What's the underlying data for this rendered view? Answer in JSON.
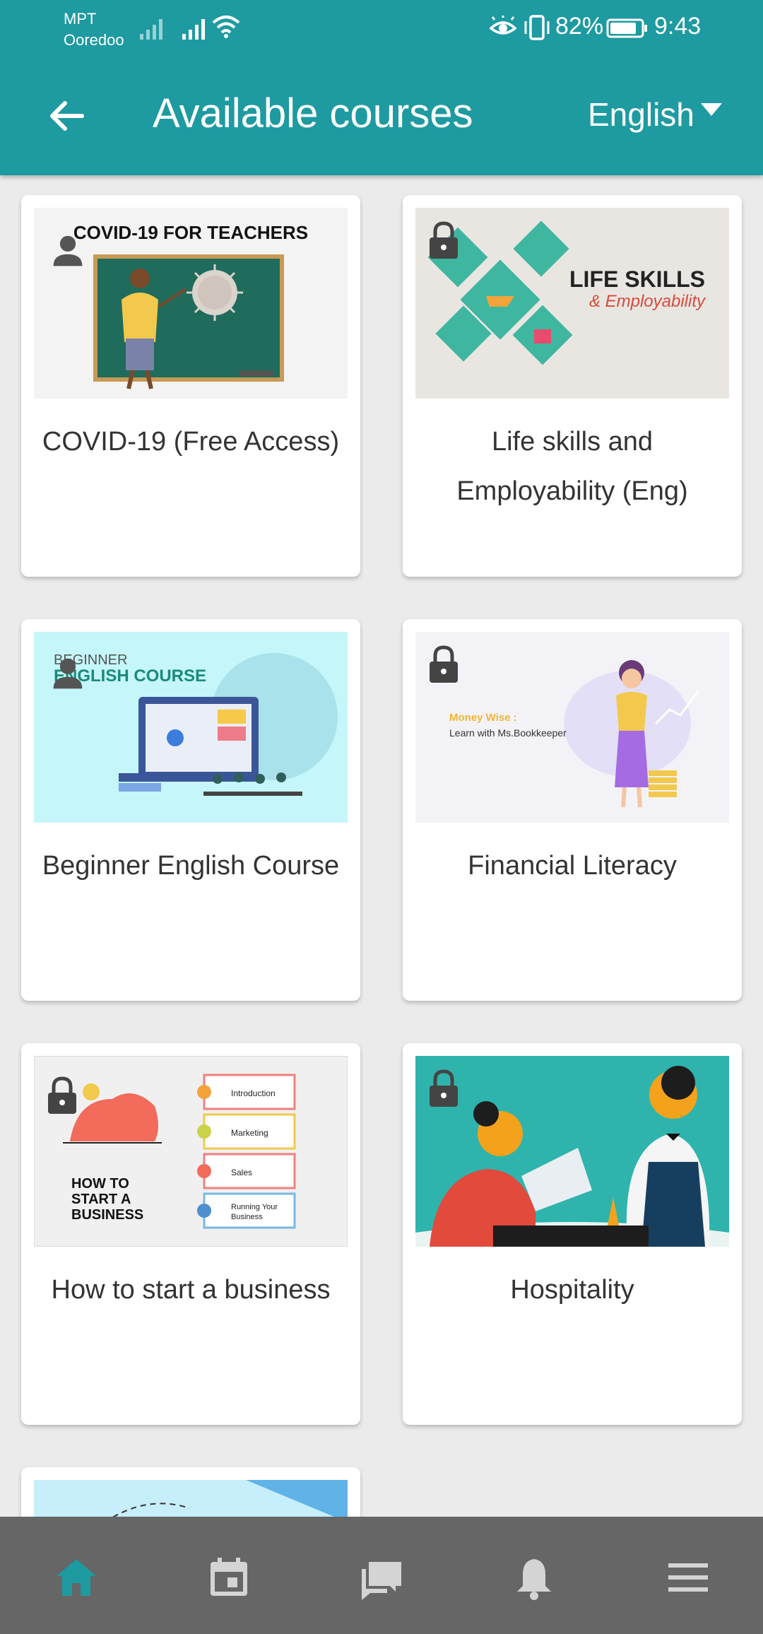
{
  "status_bar": {
    "carrier_1": "MPT",
    "carrier_2": "Ooredoo",
    "battery_percent": "82%",
    "time": "9:43"
  },
  "app_bar": {
    "title": "Available courses",
    "language": "English"
  },
  "courses": [
    {
      "title": "COVID-19 (Free Access)",
      "thumb_text": "COVID-19 FOR TEACHERS",
      "locked": false
    },
    {
      "title": "Life skills and Employability (Eng)",
      "thumb_text_1": "LIFE SKILLS",
      "thumb_text_2": "& Employability",
      "locked": true
    },
    {
      "title": "Beginner English Course",
      "thumb_text_1": "BEGINNER",
      "thumb_text_2": "ENGLISH COURSE",
      "locked": false
    },
    {
      "title": "Financial Literacy",
      "thumb_text_1": "Money Wise :",
      "thumb_text_2": "Learn with Ms.Bookkeeper",
      "locked": true
    },
    {
      "title": "How to start a business",
      "thumb_text_1": "HOW TO",
      "thumb_text_2": "START A",
      "thumb_text_3": "BUSINESS",
      "steps": [
        "Introduction",
        "Marketing",
        "Sales",
        "Running Your",
        "Business"
      ],
      "locked": true
    },
    {
      "title": "Hospitality",
      "locked": true
    },
    {
      "title": "",
      "locked": false
    }
  ],
  "bottom_nav": {
    "items": [
      "home-icon",
      "calendar-icon",
      "messages-icon",
      "notifications-icon",
      "menu-icon"
    ],
    "active_color": "#1e9aa1",
    "inactive_color": "#d4d4d4"
  },
  "colors": {
    "primary": "#1e9aa1",
    "background": "#ebebeb",
    "nav_bg": "#666666"
  }
}
